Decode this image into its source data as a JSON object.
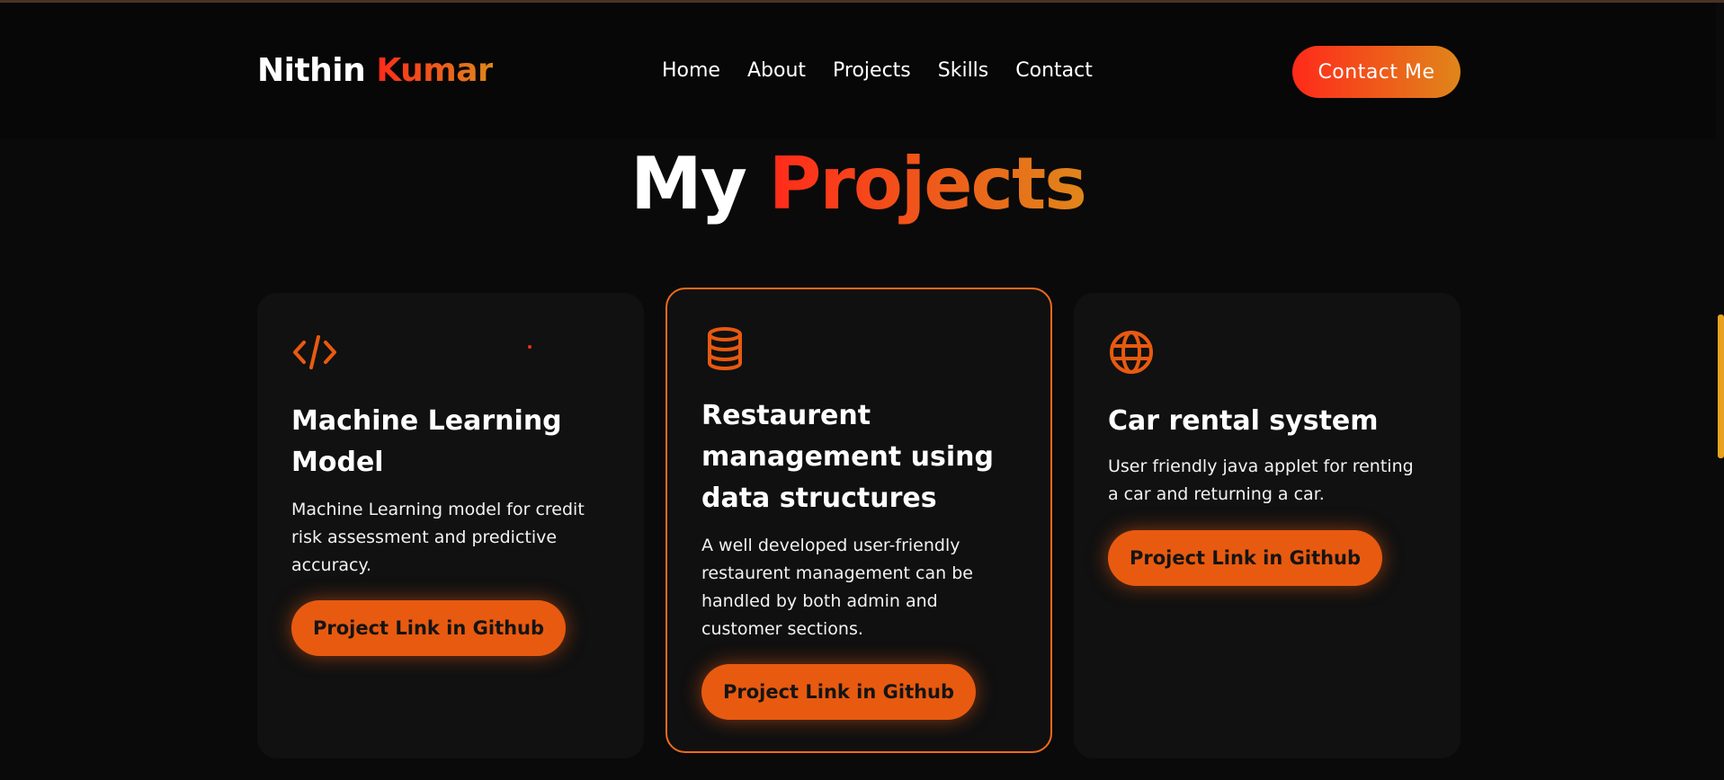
{
  "nav": {
    "logo_first": "Nithin",
    "logo_last": "Kumar",
    "links": [
      "Home",
      "About",
      "Projects",
      "Skills",
      "Contact"
    ],
    "cta": "Contact Me"
  },
  "section": {
    "title_plain": "My",
    "title_accent": "Projects"
  },
  "projects": [
    {
      "icon": "code-icon",
      "title": "Machine Learning Model",
      "description": "Machine Learning model for credit risk assessment and predictive accuracy.",
      "button": "Project Link in Github"
    },
    {
      "icon": "database-icon",
      "title": "Restaurent management using data structures",
      "description": "A well developed user-friendly restaurent management can be handled by both admin and customer sections.",
      "button": "Project Link in Github"
    },
    {
      "icon": "globe-icon",
      "title": "Car rental system",
      "description": "User friendly java applet for renting a car and returning a car.",
      "button": "Project Link in Github"
    }
  ],
  "colors": {
    "accent": "#e85a10",
    "gradient_start": "#ff2a1a",
    "gradient_end": "#e0861a",
    "background": "#0a0a0a",
    "card": "#111111"
  }
}
